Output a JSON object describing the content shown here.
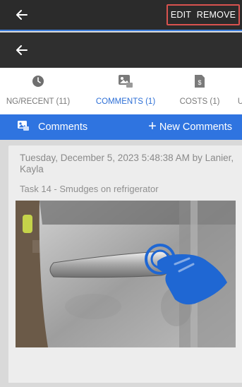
{
  "header": {
    "edit_label": "EDIT",
    "remove_label": "REMOVE",
    "back_icon": "arrow-left"
  },
  "subheader": {
    "back_icon": "arrow-left"
  },
  "tabs": [
    {
      "label": "NG/RECENT (11)",
      "icon": "clock-icon",
      "active": false
    },
    {
      "label": "COMMENTS (1)",
      "icon": "image-comment-icon",
      "active": true
    },
    {
      "label": "COSTS (1)",
      "icon": "receipt-dollar-icon",
      "active": false
    },
    {
      "label": "U",
      "icon": "",
      "active": false
    }
  ],
  "comments_bar": {
    "title": "Comments",
    "new_button_label": "New Comments"
  },
  "comment": {
    "meta": "Tuesday, December 5, 2023 5:48:38 AM by Lanier, Kayla",
    "task": "Task 14 - Smudges on refrigerator"
  },
  "colors": {
    "accent_blue": "#2f74e0",
    "active_tab_blue": "#2d6fd6",
    "top_bar": "#2b2b2b",
    "highlight_red": "#d9534f"
  }
}
